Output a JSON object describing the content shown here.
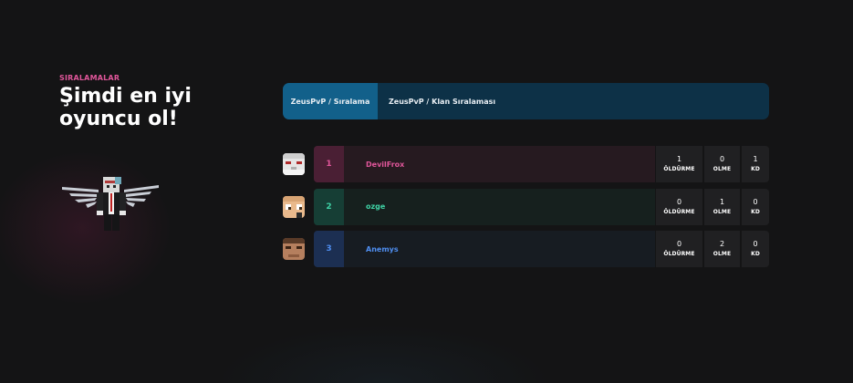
{
  "hero": {
    "kicker": "SIRALAMALAR",
    "headline": "Şimdi en iyi\noyuncu ol!"
  },
  "tabs": [
    {
      "label": "ZeusPvP / Sıralama",
      "active": true
    },
    {
      "label": "ZeusPvP / Klan Sıralaması",
      "active": false
    }
  ],
  "leaderboard": {
    "stat_labels": {
      "kills": "ÖLDÜRME",
      "deaths": "OLME",
      "kd": "KD"
    },
    "rows": [
      {
        "rank": "1",
        "name": "DevilFrox",
        "kills": "1",
        "deaths": "0",
        "kd": "1",
        "accent": "#e0569a"
      },
      {
        "rank": "2",
        "name": "ozge",
        "kills": "0",
        "deaths": "1",
        "kd": "0",
        "accent": "#3fd3a6"
      },
      {
        "rank": "3",
        "name": "Anemys",
        "kills": "0",
        "deaths": "2",
        "kd": "0",
        "accent": "#4f8ef0"
      }
    ]
  },
  "colors": {
    "background": "#141415",
    "tab_bar": "#0d3147",
    "tab_active": "#12608a",
    "kicker": "#e0569a",
    "stat_cell": "#202022"
  }
}
